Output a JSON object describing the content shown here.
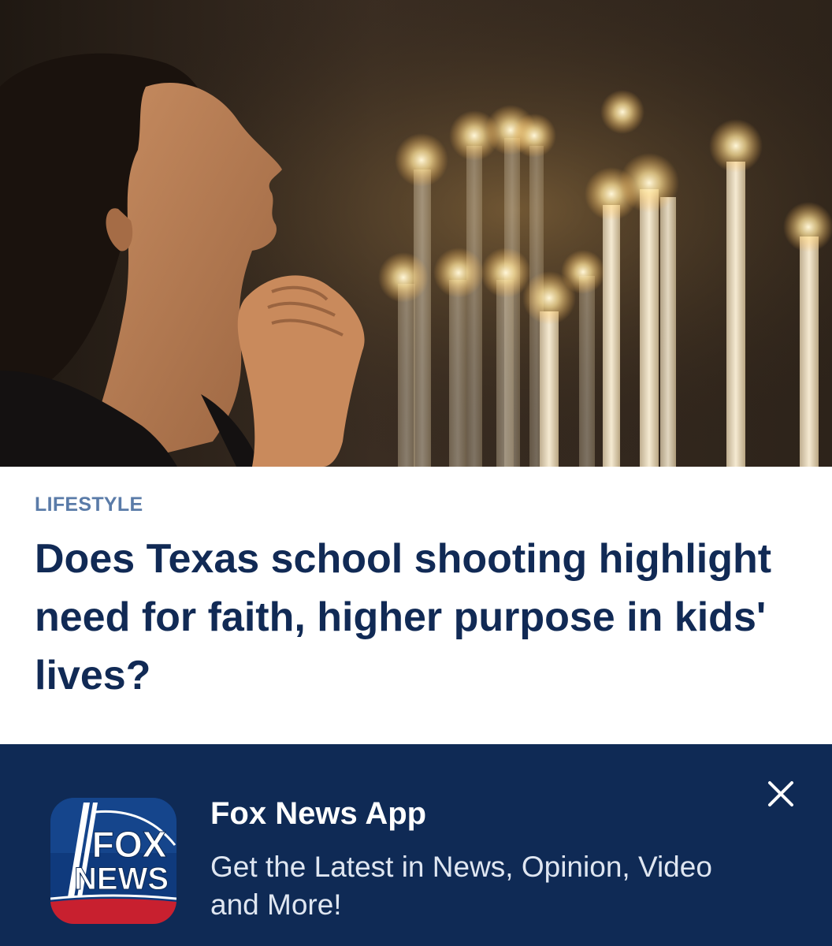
{
  "hero": {
    "icon": "article-photo-woman-praying-candles"
  },
  "article": {
    "category": "LIFESTYLE",
    "headline": "Does Texas school shooting highlight need for faith, higher purpose in kids' lives?"
  },
  "app_banner": {
    "title": "Fox News App",
    "subtitle": "Get the Latest in News, Opinion, Video and More!",
    "icon_line1": "FOX",
    "icon_line2": "NEWS",
    "close_icon": "close-icon"
  },
  "colors": {
    "category": "#5a7ba8",
    "headline": "#112a55",
    "banner_bg": "#0f2a55",
    "banner_title": "#ffffff",
    "banner_subtitle": "#dfe6f1",
    "logo_red": "#c8202f"
  }
}
